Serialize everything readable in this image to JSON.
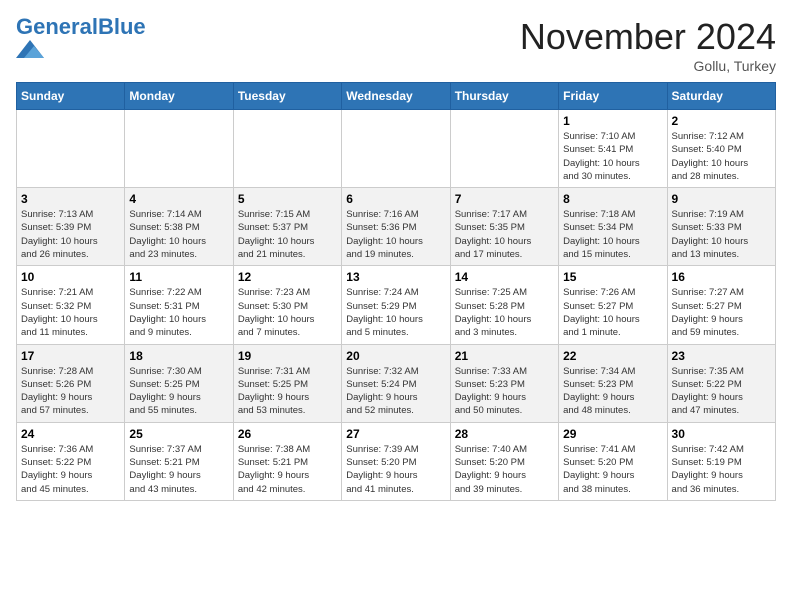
{
  "header": {
    "logo_general": "General",
    "logo_blue": "Blue",
    "month": "November 2024",
    "location": "Gollu, Turkey"
  },
  "weekdays": [
    "Sunday",
    "Monday",
    "Tuesday",
    "Wednesday",
    "Thursday",
    "Friday",
    "Saturday"
  ],
  "weeks": [
    [
      {
        "day": "",
        "info": ""
      },
      {
        "day": "",
        "info": ""
      },
      {
        "day": "",
        "info": ""
      },
      {
        "day": "",
        "info": ""
      },
      {
        "day": "",
        "info": ""
      },
      {
        "day": "1",
        "info": "Sunrise: 7:10 AM\nSunset: 5:41 PM\nDaylight: 10 hours\nand 30 minutes."
      },
      {
        "day": "2",
        "info": "Sunrise: 7:12 AM\nSunset: 5:40 PM\nDaylight: 10 hours\nand 28 minutes."
      }
    ],
    [
      {
        "day": "3",
        "info": "Sunrise: 7:13 AM\nSunset: 5:39 PM\nDaylight: 10 hours\nand 26 minutes."
      },
      {
        "day": "4",
        "info": "Sunrise: 7:14 AM\nSunset: 5:38 PM\nDaylight: 10 hours\nand 23 minutes."
      },
      {
        "day": "5",
        "info": "Sunrise: 7:15 AM\nSunset: 5:37 PM\nDaylight: 10 hours\nand 21 minutes."
      },
      {
        "day": "6",
        "info": "Sunrise: 7:16 AM\nSunset: 5:36 PM\nDaylight: 10 hours\nand 19 minutes."
      },
      {
        "day": "7",
        "info": "Sunrise: 7:17 AM\nSunset: 5:35 PM\nDaylight: 10 hours\nand 17 minutes."
      },
      {
        "day": "8",
        "info": "Sunrise: 7:18 AM\nSunset: 5:34 PM\nDaylight: 10 hours\nand 15 minutes."
      },
      {
        "day": "9",
        "info": "Sunrise: 7:19 AM\nSunset: 5:33 PM\nDaylight: 10 hours\nand 13 minutes."
      }
    ],
    [
      {
        "day": "10",
        "info": "Sunrise: 7:21 AM\nSunset: 5:32 PM\nDaylight: 10 hours\nand 11 minutes."
      },
      {
        "day": "11",
        "info": "Sunrise: 7:22 AM\nSunset: 5:31 PM\nDaylight: 10 hours\nand 9 minutes."
      },
      {
        "day": "12",
        "info": "Sunrise: 7:23 AM\nSunset: 5:30 PM\nDaylight: 10 hours\nand 7 minutes."
      },
      {
        "day": "13",
        "info": "Sunrise: 7:24 AM\nSunset: 5:29 PM\nDaylight: 10 hours\nand 5 minutes."
      },
      {
        "day": "14",
        "info": "Sunrise: 7:25 AM\nSunset: 5:28 PM\nDaylight: 10 hours\nand 3 minutes."
      },
      {
        "day": "15",
        "info": "Sunrise: 7:26 AM\nSunset: 5:27 PM\nDaylight: 10 hours\nand 1 minute."
      },
      {
        "day": "16",
        "info": "Sunrise: 7:27 AM\nSunset: 5:27 PM\nDaylight: 9 hours\nand 59 minutes."
      }
    ],
    [
      {
        "day": "17",
        "info": "Sunrise: 7:28 AM\nSunset: 5:26 PM\nDaylight: 9 hours\nand 57 minutes."
      },
      {
        "day": "18",
        "info": "Sunrise: 7:30 AM\nSunset: 5:25 PM\nDaylight: 9 hours\nand 55 minutes."
      },
      {
        "day": "19",
        "info": "Sunrise: 7:31 AM\nSunset: 5:25 PM\nDaylight: 9 hours\nand 53 minutes."
      },
      {
        "day": "20",
        "info": "Sunrise: 7:32 AM\nSunset: 5:24 PM\nDaylight: 9 hours\nand 52 minutes."
      },
      {
        "day": "21",
        "info": "Sunrise: 7:33 AM\nSunset: 5:23 PM\nDaylight: 9 hours\nand 50 minutes."
      },
      {
        "day": "22",
        "info": "Sunrise: 7:34 AM\nSunset: 5:23 PM\nDaylight: 9 hours\nand 48 minutes."
      },
      {
        "day": "23",
        "info": "Sunrise: 7:35 AM\nSunset: 5:22 PM\nDaylight: 9 hours\nand 47 minutes."
      }
    ],
    [
      {
        "day": "24",
        "info": "Sunrise: 7:36 AM\nSunset: 5:22 PM\nDaylight: 9 hours\nand 45 minutes."
      },
      {
        "day": "25",
        "info": "Sunrise: 7:37 AM\nSunset: 5:21 PM\nDaylight: 9 hours\nand 43 minutes."
      },
      {
        "day": "26",
        "info": "Sunrise: 7:38 AM\nSunset: 5:21 PM\nDaylight: 9 hours\nand 42 minutes."
      },
      {
        "day": "27",
        "info": "Sunrise: 7:39 AM\nSunset: 5:20 PM\nDaylight: 9 hours\nand 41 minutes."
      },
      {
        "day": "28",
        "info": "Sunrise: 7:40 AM\nSunset: 5:20 PM\nDaylight: 9 hours\nand 39 minutes."
      },
      {
        "day": "29",
        "info": "Sunrise: 7:41 AM\nSunset: 5:20 PM\nDaylight: 9 hours\nand 38 minutes."
      },
      {
        "day": "30",
        "info": "Sunrise: 7:42 AM\nSunset: 5:19 PM\nDaylight: 9 hours\nand 36 minutes."
      }
    ]
  ]
}
